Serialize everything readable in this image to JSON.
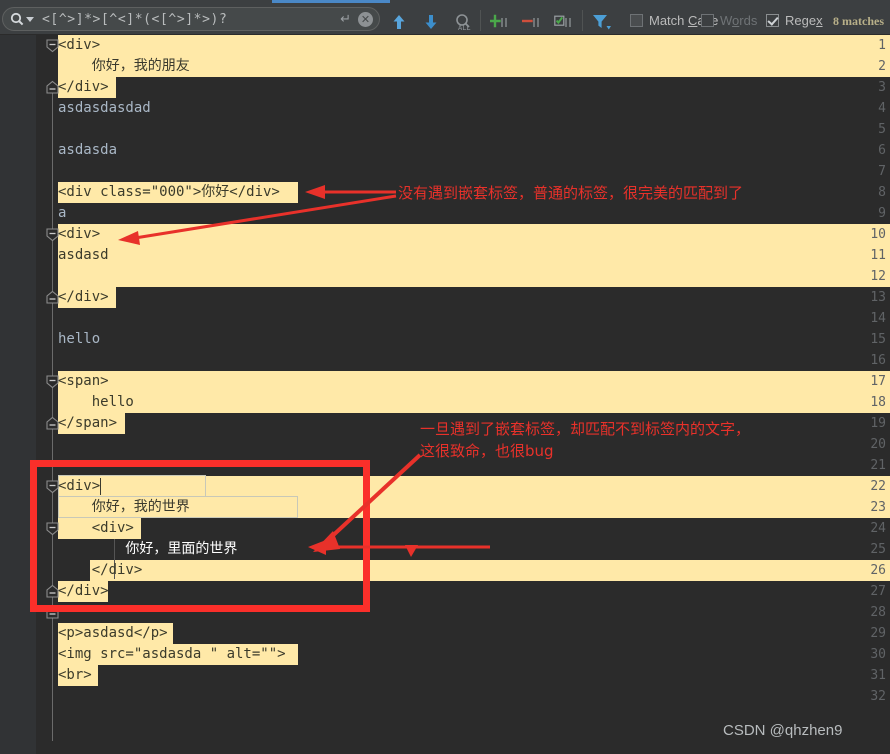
{
  "window": {
    "background": "#2b2b2b",
    "panel_background": "#3c3f41",
    "accent": "#4a88c7",
    "highlight_color": "#ffe9a8",
    "annotation_color": "#e8312a"
  },
  "find_toolbar": {
    "search_value": "<[^>]*>[^<]*(<[^>]*>)?",
    "search_placeholder": "Search",
    "enter_glyph": "↵",
    "clear_glyph": "✕",
    "icons": [
      {
        "name": "search-dropdown-icon",
        "glyph": "▾"
      },
      {
        "name": "find-previous-icon",
        "glyph": "↑"
      },
      {
        "name": "find-next-icon",
        "glyph": "↓"
      },
      {
        "name": "select-all-occurrences-icon",
        "glyph": "Ⓐ"
      },
      {
        "name": "add-line-icon",
        "glyph": "+"
      },
      {
        "name": "remove-line-icon",
        "glyph": "−"
      },
      {
        "name": "select-lines-icon",
        "glyph": "☑"
      },
      {
        "name": "filter-icon",
        "glyph": "▼"
      }
    ],
    "options": [
      {
        "name": "match-case",
        "label_prefix": "Match ",
        "label_mnemonic": "C",
        "label_suffix": "ase",
        "checked": false,
        "enabled": true
      },
      {
        "name": "words",
        "label_prefix": "W",
        "label_mnemonic": "o",
        "label_suffix": "rds",
        "checked": false,
        "enabled": false
      },
      {
        "name": "regex",
        "label_prefix": "Rege",
        "label_mnemonic": "x",
        "label_suffix": "",
        "checked": true,
        "enabled": true
      }
    ],
    "match_count": "8 matches"
  },
  "editor": {
    "language": "html",
    "lines": [
      {
        "n": "1",
        "text": "<div>"
      },
      {
        "n": "2",
        "text": "    你好，我的朋友"
      },
      {
        "n": "3",
        "text": "</div>"
      },
      {
        "n": "4",
        "text": "asdasdasdad"
      },
      {
        "n": "5",
        "text": ""
      },
      {
        "n": "6",
        "text": "asdasda"
      },
      {
        "n": "7",
        "text": ""
      },
      {
        "n": "8",
        "text": "<div class=\"000\">你好</div>"
      },
      {
        "n": "9",
        "text": "a"
      },
      {
        "n": "10",
        "text": "<div>"
      },
      {
        "n": "11",
        "text": "asdasd"
      },
      {
        "n": "12",
        "text": ""
      },
      {
        "n": "13",
        "text": "</div>"
      },
      {
        "n": "14",
        "text": ""
      },
      {
        "n": "15",
        "text": "hello"
      },
      {
        "n": "16",
        "text": ""
      },
      {
        "n": "17",
        "text": "<span>"
      },
      {
        "n": "18",
        "text": "    hello"
      },
      {
        "n": "19",
        "text": "</span>"
      },
      {
        "n": "20",
        "text": ""
      },
      {
        "n": "21",
        "text": ""
      },
      {
        "n": "22",
        "text": "<div>"
      },
      {
        "n": "23",
        "text": "    你好，我的世界"
      },
      {
        "n": "24",
        "text": "    <div>"
      },
      {
        "n": "25",
        "text": "        你好，里面的世界"
      },
      {
        "n": "26",
        "text": "    </div>"
      },
      {
        "n": "27",
        "text": "</div>"
      },
      {
        "n": "28",
        "text": ""
      },
      {
        "n": "29",
        "text": "<p>asdasd</p>"
      },
      {
        "n": "30",
        "text": "<img src=\"asdasda \" alt=\"\">"
      },
      {
        "n": "31",
        "text": "<br>"
      },
      {
        "n": "32",
        "text": ""
      }
    ],
    "fold_markers": [
      {
        "line": "1",
        "state": "expanded-open"
      },
      {
        "line": "3",
        "state": "expanded-close"
      },
      {
        "line": "10",
        "state": "expanded-open"
      },
      {
        "line": "13",
        "state": "expanded-close"
      },
      {
        "line": "17",
        "state": "expanded-open"
      },
      {
        "line": "19",
        "state": "expanded-close"
      },
      {
        "line": "22",
        "state": "expanded-open"
      },
      {
        "line": "24",
        "state": "expanded-open"
      },
      {
        "line": "26",
        "state": "expanded-close"
      },
      {
        "line": "27",
        "state": "expanded-close"
      }
    ],
    "caret_line": "22"
  },
  "annotations": [
    {
      "name": "annotation-simple-tag",
      "lines": [
        "没有遇到嵌套标签，普通的标签，很完美的匹配到了"
      ]
    },
    {
      "name": "annotation-nested-tag",
      "lines": [
        "一旦遇到了嵌套标签，却匹配不到标签内的文字，",
        "这很致命，也很bug"
      ]
    }
  ],
  "watermark": "CSDN @qhzhen9"
}
